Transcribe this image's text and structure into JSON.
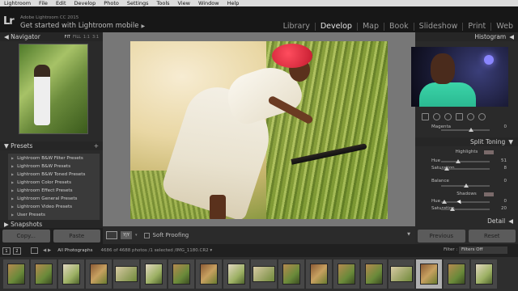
{
  "menu": [
    "Lightroom",
    "File",
    "Edit",
    "Develop",
    "Photo",
    "Settings",
    "Tools",
    "View",
    "Window",
    "Help"
  ],
  "identity": {
    "logo": "Lr",
    "app_name": "Adobe Lightroom CC 2015",
    "mobile_label": "Get started with Lightroom mobile",
    "mobile_arrow": "▶"
  },
  "modules": [
    "Library",
    "Develop",
    "Map",
    "Book",
    "Slideshow",
    "Print",
    "Web"
  ],
  "active_module": "Develop",
  "left_panel": {
    "navigator_title": "Navigator",
    "zoom": [
      "FIT",
      "FILL",
      "1:1",
      "3:1"
    ],
    "presets_title": "Presets",
    "presets_plus": "+",
    "presets": [
      "Lightroom B&W Filter Presets",
      "Lightroom B&W Presets",
      "Lightroom B&W Toned Presets",
      "Lightroom Color Presets",
      "Lightroom Effect Presets",
      "Lightroom General Presets",
      "Lightroom Video Presets",
      "User Presets"
    ],
    "snapshots_title": "Snapshots",
    "copy_button": "Copy...",
    "paste_button": "Paste"
  },
  "toolbar": {
    "soft_proofing": "Soft Proofing",
    "view_icon_text": "Y|Y"
  },
  "right_panel": {
    "histogram_title": "Histogram",
    "magenta_label": "Magenta",
    "magenta_value": "0",
    "split_toning_title": "Split Toning",
    "highlights_label": "Highlights",
    "hl_hue_label": "Hue",
    "hl_hue_value": "51",
    "hl_sat_label": "Saturation",
    "hl_sat_value": "8",
    "balance_label": "Balance",
    "balance_value": "0",
    "shadows_label": "Shadows",
    "sh_hue_label": "Hue",
    "sh_hue_value": "0",
    "sh_sat_label": "Saturation",
    "sh_sat_value": "20",
    "detail_title": "Detail",
    "previous_button": "Previous",
    "reset_button": "Reset"
  },
  "filmbar": {
    "screen1": "1",
    "screen2": "2",
    "arrows": "◀ ▶",
    "source": "All Photographs",
    "info": "4686 of 4688 photos /1 selected /IMG_1180.CR2 ▾",
    "filter_label": "Filter :",
    "filter_value": "Filters Off"
  },
  "colors": {
    "accent": "#e6e6e6",
    "panel_bg": "#2a2a2a",
    "center_bg": "#777777"
  }
}
